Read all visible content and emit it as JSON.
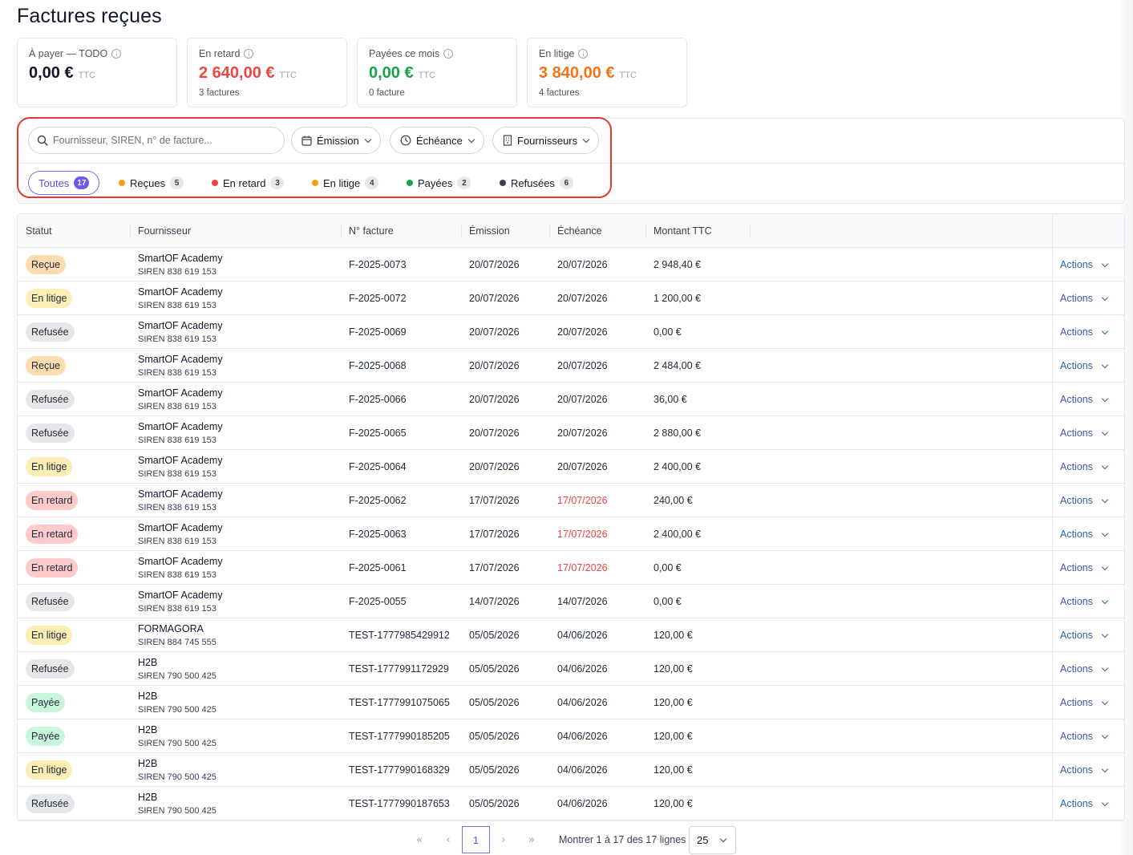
{
  "page": {
    "title": "Factures reçues"
  },
  "stats": [
    {
      "label": "À payer — TODO",
      "value": "0,00 €",
      "unit": "TTC",
      "sub": "",
      "color": "#111827"
    },
    {
      "label": "En retard",
      "value": "2 640,00 €",
      "unit": "TTC",
      "sub": "3 factures",
      "color": "#ef4444"
    },
    {
      "label": "Payées ce mois",
      "value": "0,00 €",
      "unit": "TTC",
      "sub": "0 facture",
      "color": "#16a34a"
    },
    {
      "label": "En litige",
      "value": "3 840,00 €",
      "unit": "TTC",
      "sub": "4 factures",
      "color": "#f97316"
    }
  ],
  "filters": {
    "search_placeholder": "Fournisseur, SIREN, n° de facture...",
    "emission_label": "Émission",
    "echeance_label": "Échéance",
    "suppliers_label": "Fournisseurs"
  },
  "tabs": [
    {
      "label": "Toutes",
      "count": "17",
      "dot": ""
    },
    {
      "label": "Reçues",
      "count": "5",
      "dot": "#f59e0b"
    },
    {
      "label": "En retard",
      "count": "3",
      "dot": "#ef4444"
    },
    {
      "label": "En litige",
      "count": "4",
      "dot": "#f59e0b"
    },
    {
      "label": "Payées",
      "count": "2",
      "dot": "#16a34a"
    },
    {
      "label": "Refusées",
      "count": "6",
      "dot": "#374151"
    }
  ],
  "table": {
    "columns": [
      "Statut",
      "Fournisseur",
      "N° facture",
      "Émission",
      "Échéance",
      "Montant TTC"
    ],
    "actions_label": "Actions",
    "status_colors": {
      "Reçue": "#fddcb0",
      "En litige": "#fdeeb5",
      "Refusée": "#e5e7eb",
      "En retard": "#fecaca",
      "Payée": "#c8f5dc"
    },
    "overdue_color": "#ef4444",
    "rows": [
      {
        "status": "Reçue",
        "supplier": "SmartOF Academy",
        "siren": "SIREN 838 619 153",
        "invoice": "F-2025-0073",
        "emission": "20/07/2026",
        "due": "20/07/2026",
        "overdue": false,
        "amount": "2 948,40 €"
      },
      {
        "status": "En litige",
        "supplier": "SmartOF Academy",
        "siren": "SIREN 838 619 153",
        "invoice": "F-2025-0072",
        "emission": "20/07/2026",
        "due": "20/07/2026",
        "overdue": false,
        "amount": "1 200,00 €"
      },
      {
        "status": "Refusée",
        "supplier": "SmartOF Academy",
        "siren": "SIREN 838 619 153",
        "invoice": "F-2025-0069",
        "emission": "20/07/2026",
        "due": "20/07/2026",
        "overdue": false,
        "amount": "0,00 €"
      },
      {
        "status": "Reçue",
        "supplier": "SmartOF Academy",
        "siren": "SIREN 838 619 153",
        "invoice": "F-2025-0068",
        "emission": "20/07/2026",
        "due": "20/07/2026",
        "overdue": false,
        "amount": "2 484,00 €"
      },
      {
        "status": "Refusée",
        "supplier": "SmartOF Academy",
        "siren": "SIREN 838 619 153",
        "invoice": "F-2025-0066",
        "emission": "20/07/2026",
        "due": "20/07/2026",
        "overdue": false,
        "amount": "36,00 €"
      },
      {
        "status": "Refusée",
        "supplier": "SmartOF Academy",
        "siren": "SIREN 838 619 153",
        "invoice": "F-2025-0065",
        "emission": "20/07/2026",
        "due": "20/07/2026",
        "overdue": false,
        "amount": "2 880,00 €"
      },
      {
        "status": "En litige",
        "supplier": "SmartOF Academy",
        "siren": "SIREN 838 619 153",
        "invoice": "F-2025-0064",
        "emission": "20/07/2026",
        "due": "20/07/2026",
        "overdue": false,
        "amount": "2 400,00 €"
      },
      {
        "status": "En retard",
        "supplier": "SmartOF Academy",
        "siren": "SIREN 838 619 153",
        "invoice": "F-2025-0062",
        "emission": "17/07/2026",
        "due": "17/07/2026",
        "overdue": true,
        "amount": "240,00 €"
      },
      {
        "status": "En retard",
        "supplier": "SmartOF Academy",
        "siren": "SIREN 838 619 153",
        "invoice": "F-2025-0063",
        "emission": "17/07/2026",
        "due": "17/07/2026",
        "overdue": true,
        "amount": "2 400,00 €"
      },
      {
        "status": "En retard",
        "supplier": "SmartOF Academy",
        "siren": "SIREN 838 619 153",
        "invoice": "F-2025-0061",
        "emission": "17/07/2026",
        "due": "17/07/2026",
        "overdue": true,
        "amount": "0,00 €"
      },
      {
        "status": "Refusée",
        "supplier": "SmartOF Academy",
        "siren": "SIREN 838 619 153",
        "invoice": "F-2025-0055",
        "emission": "14/07/2026",
        "due": "14/07/2026",
        "overdue": false,
        "amount": "0,00 €"
      },
      {
        "status": "En litige",
        "supplier": "FORMAGORA",
        "siren": "SIREN 884 745 555",
        "invoice": "TEST-1777985429912",
        "emission": "05/05/2026",
        "due": "04/06/2026",
        "overdue": false,
        "amount": "120,00 €"
      },
      {
        "status": "Refusée",
        "supplier": "H2B",
        "siren": "SIREN 790 500 425",
        "invoice": "TEST-1777991172929",
        "emission": "05/05/2026",
        "due": "04/06/2026",
        "overdue": false,
        "amount": "120,00 €"
      },
      {
        "status": "Payée",
        "supplier": "H2B",
        "siren": "SIREN 790 500 425",
        "invoice": "TEST-1777991075065",
        "emission": "05/05/2026",
        "due": "04/06/2026",
        "overdue": false,
        "amount": "120,00 €"
      },
      {
        "status": "Payée",
        "supplier": "H2B",
        "siren": "SIREN 790 500 425",
        "invoice": "TEST-1777990185205",
        "emission": "05/05/2026",
        "due": "04/06/2026",
        "overdue": false,
        "amount": "120,00 €"
      },
      {
        "status": "En litige",
        "supplier": "H2B",
        "siren": "SIREN 790 500 425",
        "invoice": "TEST-1777990168329",
        "emission": "05/05/2026",
        "due": "04/06/2026",
        "overdue": false,
        "amount": "120,00 €"
      },
      {
        "status": "Refusée",
        "supplier": "H2B",
        "siren": "SIREN 790 500 425",
        "invoice": "TEST-1777990187653",
        "emission": "05/05/2026",
        "due": "04/06/2026",
        "overdue": false,
        "amount": "120,00 €"
      }
    ]
  },
  "pagination": {
    "first": "«",
    "prev": "‹",
    "current": "1",
    "next": "›",
    "last": "»",
    "info": "Montrer 1 à 17 des 17 lignes",
    "page_size": "25"
  }
}
